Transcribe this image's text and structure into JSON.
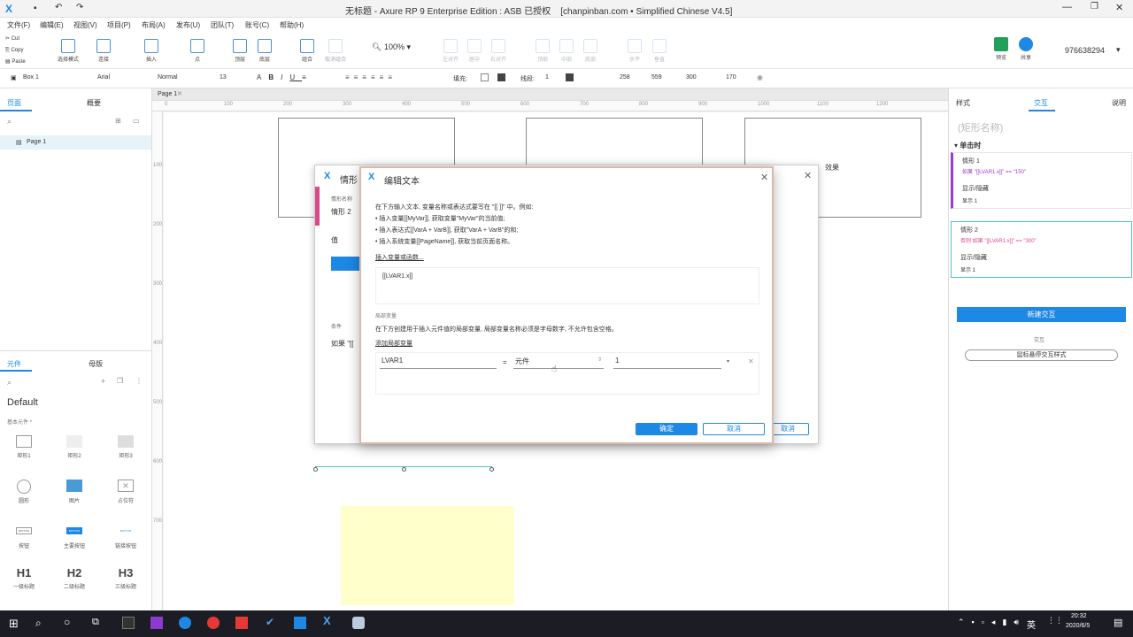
{
  "titlebar": {
    "app_icon": "axure-x-icon",
    "title": "无标题 - Axure RP 9 Enterprise Edition : ASB 已授权    [chanpinban.com • Simplified Chinese V4.5]"
  },
  "menu": [
    "文件(F)",
    "编辑(E)",
    "视图(V)",
    "项目(P)",
    "布局(A)",
    "发布(U)",
    "团队(T)",
    "账号(C)",
    "帮助(H)"
  ],
  "clipboard": [
    "Cut",
    "Copy",
    "Paste"
  ],
  "ribbon": [
    "选择模式",
    "连接",
    "插入",
    "点",
    "顶层",
    "底层",
    "组合",
    "取消组合",
    "左对齐",
    "居中",
    "右对齐",
    "顶部",
    "中部",
    "底部",
    "水平",
    "垂直"
  ],
  "zoom": "100%",
  "preview": "预览",
  "share": "共享",
  "account": "976638294",
  "fmt": {
    "widget": "Box 1",
    "font": "Arial",
    "style": "Normal",
    "size": "13",
    "fill": "填充:",
    "line": "线段:",
    "line_val": "1",
    "x": "258",
    "y": "559",
    "w": "300",
    "h": "170"
  },
  "left": {
    "tab_pages": "页面",
    "tab_outline": "概要",
    "page1": "Page 1",
    "tab_libs": "元件",
    "tab_masters": "母版",
    "library": "Default",
    "section": "基本元件 *",
    "items": [
      "矩形1",
      "矩形2",
      "矩形3",
      "圆形",
      "图片",
      "占位符",
      "按钮",
      "主要按钮",
      "链接按钮",
      "一级标题",
      "二级标题",
      "三级标题"
    ],
    "h": [
      "H1",
      "H2",
      "H3"
    ],
    "btn_text": "BUTTON"
  },
  "canvas": {
    "tab": "Page 1",
    "ruler": [
      "0",
      "100",
      "200",
      "300",
      "400",
      "500",
      "600",
      "700",
      "800",
      "900",
      "1000",
      "1100",
      "1200"
    ],
    "vruler": [
      "100",
      "200",
      "300",
      "400",
      "500",
      "600",
      "700"
    ],
    "box3": "效果"
  },
  "right": {
    "tab_style": "样式",
    "tab_interact": "交互",
    "tab_notes": "说明",
    "shape_name": "(矩形名称)",
    "event": "单击时",
    "case1": "情形 1",
    "cond1": "如果 \"[[LVAR1.x]]\" == \"150\"",
    "act1": "显示/隐藏",
    "act1_target": "显示 1",
    "case2": "情形 2",
    "cond2": "否则 如果 \"[[LVAR1.x]]\" == \"300\"",
    "act2": "显示/隐藏",
    "act2_target": "显示 1",
    "new_interaction": "新建交互",
    "hover_label": "交互",
    "hover_style": "鼠标悬停交互样式"
  },
  "case_dialog": {
    "title": "情形",
    "name_label": "情形名称",
    "name_value": "情形 2",
    "value_label": "值",
    "condition_label": "条件",
    "condition_preview": "如果 \"[[",
    "cancel": "取消"
  },
  "edit_dialog": {
    "title": "编辑文本",
    "intro": "在下方输入文本, 变量名称或表达式要写在 \"[[ ]]\" 中。例如:",
    "ex1": "• 插入变量[[MyVar]], 获取变量\"MyVar\"的当前值;",
    "ex2": "• 插入表达式[[VarA + VarB]], 获取\"VarA + VarB\"的和;",
    "ex3": "• 插入系统变量[[PageName]], 获取当前页面名称。",
    "insert_link": "插入变量或函数...",
    "text_value": "[[LVAR1.x]]",
    "local_title": "局部变量",
    "local_desc": "在下方创建用于插入元件值的局部变量, 局部变量名称必须是字母数字, 不允许包含空格。",
    "add_local": "添加局部变量",
    "var_name": "LVAR1",
    "eq": "=",
    "var_type": "元件",
    "var_target": "1",
    "ok": "确定",
    "cancel": "取消"
  },
  "taskbar": {
    "lang": "英",
    "time": "20:32",
    "date": "2020/6/5"
  },
  "colors": {
    "accent": "#1e88e5",
    "pink": "#e0468a",
    "purple": "#9b3bd1",
    "teal": "#4fc3c9"
  }
}
